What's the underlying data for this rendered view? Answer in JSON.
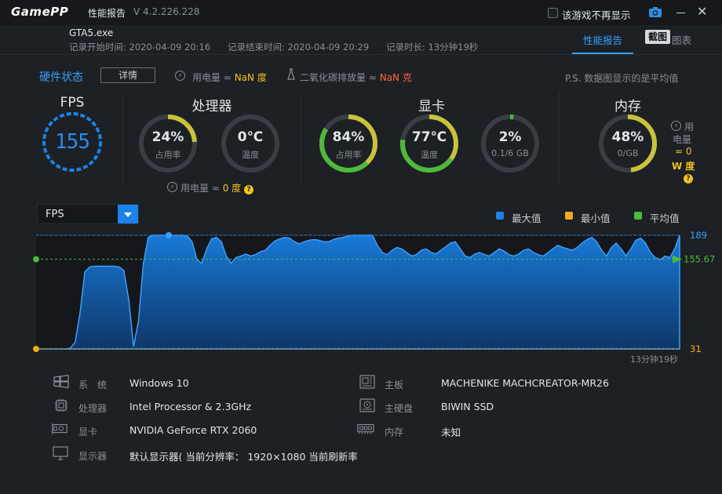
{
  "app": {
    "logo_game": "Game",
    "logo_pp": "PP",
    "title": "性能报告",
    "version": "V 4.2.226.228",
    "dont_show_label": "该游戏不再显示"
  },
  "session": {
    "exe": "GTA5.exe",
    "start": "记录开始时间: 2020-04-09 20:16",
    "end": "记录结束时间: 2020-04-09 20:29",
    "duration": "记录时长: 13分钟19秒"
  },
  "tabs": {
    "report": "性能报告",
    "screenshot": "截图",
    "chart": "图表"
  },
  "hardware": {
    "title": "硬件状态",
    "detail_button": "详情",
    "power_label": "用电量 ≈",
    "power_value": "NaN 度",
    "co2_label": "二氧化碳排放量 ≈",
    "co2_value": "NaN 克",
    "note": "P.S. 数据图显示的是平均值"
  },
  "sections": {
    "fps": {
      "title": "FPS",
      "value": "155"
    },
    "cpu": {
      "title": "处理器",
      "usage": "24%",
      "usage_label": "占用率",
      "usage_level": 0.24,
      "temp": "0℃",
      "temp_label": "温度",
      "temp_level": 0,
      "power_label": "用电量 ≈",
      "power_value": "0 度"
    },
    "gpu": {
      "title": "显卡",
      "usage": "84%",
      "usage_label": "占用率",
      "usage_level": 0.84,
      "temp": "77℃",
      "temp_label": "温度",
      "temp_level": 0.77,
      "vram": "2%",
      "vram_label": "0.1/6 GB",
      "vram_level": 0.02
    },
    "mem": {
      "title": "内存",
      "usage": "48%",
      "usage_label": "0/GB",
      "usage_level": 0.48,
      "power_line1": "用",
      "power_line2": "电量",
      "power_line3": "≈ 0",
      "power_line4": "W 度"
    }
  },
  "chart_panel": {
    "selector": "FPS",
    "legend": [
      {
        "label": "最大值",
        "color": "#1a82e8"
      },
      {
        "label": "最小值",
        "color": "#f4a91e"
      },
      {
        "label": "平均值",
        "color": "#4cba3c"
      }
    ],
    "max_label": "189",
    "avg_label": "155.67",
    "min_label": "31",
    "duration_label": "13分钟19秒"
  },
  "chart_data": {
    "type": "area",
    "title": "FPS",
    "ylim": [
      31,
      189
    ],
    "max": 189,
    "min": 31,
    "avg": 155.67,
    "values": [
      31,
      31,
      31,
      31,
      31,
      31,
      31,
      32,
      40,
      80,
      138,
      145,
      146,
      146,
      146,
      146,
      146,
      145,
      140,
      100,
      34,
      70,
      150,
      186,
      189,
      189,
      189,
      189,
      189,
      189,
      189,
      188,
      180,
      155,
      150,
      170,
      184,
      186,
      180,
      160,
      150,
      158,
      160,
      163,
      160,
      162,
      166,
      168,
      175,
      181,
      184,
      186,
      185,
      180,
      177,
      180,
      182,
      183,
      182,
      180,
      180,
      183,
      185,
      186,
      188,
      189,
      189,
      189,
      189,
      189,
      175,
      165,
      162,
      168,
      172,
      170,
      165,
      160,
      162,
      168,
      170,
      165,
      163,
      168,
      173,
      178,
      180,
      170,
      160,
      158,
      163,
      165,
      162,
      160,
      165,
      170,
      167,
      162,
      160,
      163,
      168,
      170,
      165,
      162,
      160,
      165,
      170,
      175,
      172,
      170,
      168,
      172,
      178,
      183,
      186,
      180,
      168,
      160,
      172,
      178,
      170,
      160,
      170,
      182,
      185,
      178,
      165,
      158,
      155,
      160,
      158,
      170,
      189
    ],
    "y_ticks": [
      "189",
      "155.67",
      "31"
    ],
    "x_end_label": "13分钟19秒"
  },
  "system_info": {
    "os_key": "系　统",
    "os_val": "Windows 10",
    "cpu_key": "处理器",
    "cpu_val": "Intel Processor & 2.3GHz",
    "gpu_key": "显卡",
    "gpu_val": "NVIDIA GeForce RTX 2060",
    "display_key": "显示器",
    "display_val": "默认显示器( 当前分辨率： 1920×1080 当前刷新率： 1⁄",
    "board_key": "主板",
    "board_val": "MACHENIKE MACHCREATOR-MR26",
    "disk_key": "主硬盘",
    "disk_val": "BIWIN SSD",
    "mem_key": "内存",
    "mem_val": "未知"
  }
}
